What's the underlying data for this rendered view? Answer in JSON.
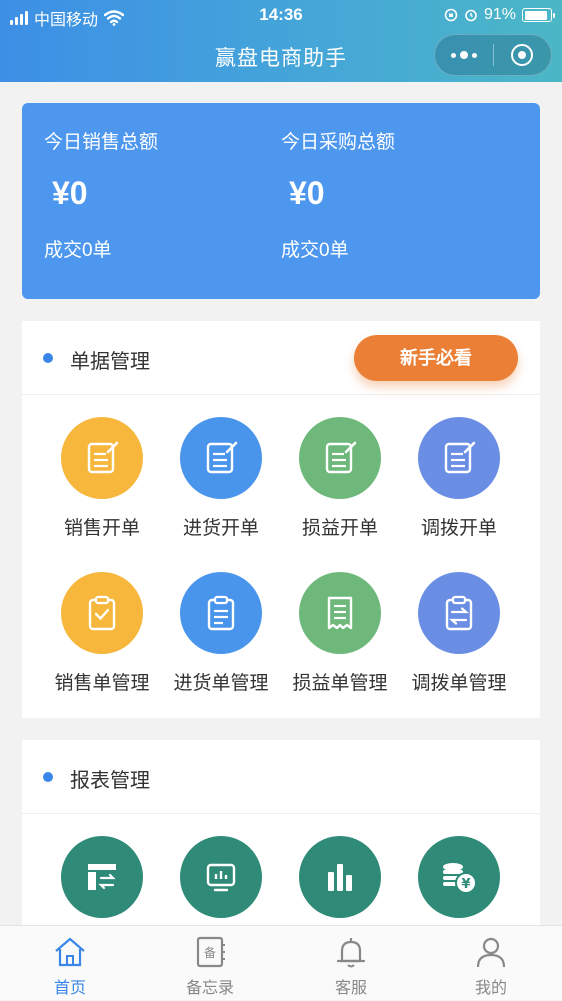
{
  "status_bar": {
    "carrier": "中国移动",
    "time": "14:36",
    "battery": "91%"
  },
  "nav": {
    "title": "赢盘电商助手"
  },
  "summary": {
    "sales_label": "今日销售总额",
    "sales_amount": "¥0",
    "sales_deals": "成交0单",
    "purchase_label": "今日采购总额",
    "purchase_amount": "¥0",
    "purchase_deals": "成交0单"
  },
  "documents": {
    "title": "单据管理",
    "guide_button": "新手必看",
    "items": [
      {
        "label": "销售开单",
        "icon": "edit-doc-icon",
        "color": "#f6b73c"
      },
      {
        "label": "进货开单",
        "icon": "edit-doc-icon",
        "color": "#4a95ec"
      },
      {
        "label": "损益开单",
        "icon": "edit-doc-icon",
        "color": "#6db87a"
      },
      {
        "label": "调拨开单",
        "icon": "edit-doc-icon",
        "color": "#6b8ee5"
      },
      {
        "label": "销售单管理",
        "icon": "clipboard-check-icon",
        "color": "#f6b73c"
      },
      {
        "label": "进货单管理",
        "icon": "clipboard-list-icon",
        "color": "#4a95ec"
      },
      {
        "label": "损益单管理",
        "icon": "receipt-icon",
        "color": "#6db87a"
      },
      {
        "label": "调拨单管理",
        "icon": "clipboard-transfer-icon",
        "color": "#6b8ee5"
      }
    ]
  },
  "reports": {
    "title": "报表管理",
    "items": [
      {
        "icon": "report-table-icon",
        "color": "#2f8a78"
      },
      {
        "icon": "monitor-chart-icon",
        "color": "#2f8a78"
      },
      {
        "icon": "bar-chart-icon",
        "color": "#2f8a78"
      },
      {
        "icon": "yen-coins-icon",
        "color": "#2f8a78"
      }
    ]
  },
  "tabbar": {
    "tabs": [
      {
        "label": "首页",
        "icon": "home-icon",
        "active": true
      },
      {
        "label": "备忘录",
        "icon": "memo-icon",
        "active": false
      },
      {
        "label": "客服",
        "icon": "bell-icon",
        "active": false
      },
      {
        "label": "我的",
        "icon": "user-icon",
        "active": false
      }
    ],
    "active_color": "#3a86e8"
  }
}
